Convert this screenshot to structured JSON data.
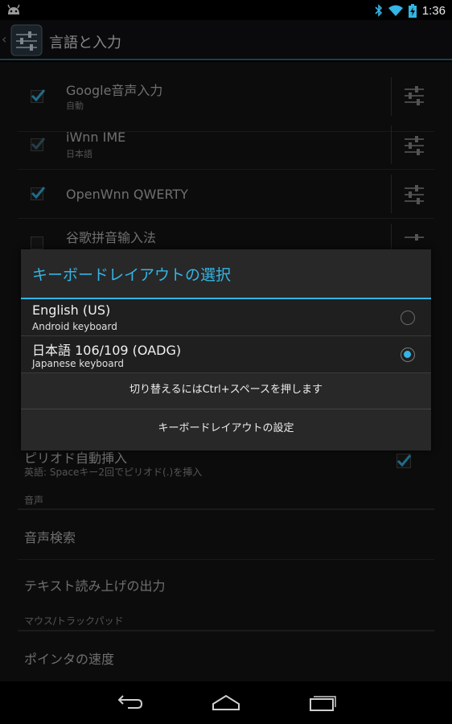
{
  "statusbar": {
    "time": "1:36",
    "icons": [
      "android-icon",
      "bluetooth-icon",
      "wifi-icon",
      "battery-charging-icon"
    ]
  },
  "actionbar": {
    "title": "言語と入力",
    "icon": "input-settings-icon"
  },
  "input_methods": [
    {
      "name": "Google音声入力",
      "sub": "自動",
      "checked": true
    },
    {
      "name": "iWnn IME",
      "sub": "日本語",
      "checked": true
    },
    {
      "name": "OpenWnn QWERTY",
      "sub": "",
      "checked": true
    },
    {
      "name": "谷歌拼音输入法",
      "sub": "",
      "checked": false
    }
  ],
  "behind": {
    "period_title": "ピリオド自動挿入",
    "period_sub": "英語: Spaceキー2回でピリオド(.)を挿入",
    "section_voice": "音声",
    "voice_search": "音声検索",
    "tts": "テキスト読み上げの出力",
    "section_mouse": "マウス/トラックパッド",
    "pointer_speed": "ポインタの速度"
  },
  "dialog": {
    "title": "キーボードレイアウトの選択",
    "options": [
      {
        "name": "English (US)",
        "sub": "Android keyboard",
        "selected": false
      },
      {
        "name": "日本語 106/109 (OADG)",
        "sub": "Japanese keyboard",
        "selected": true
      }
    ],
    "hint": "切り替えるにはCtrl+スペースを押します",
    "settings_button": "キーボードレイアウトの設定"
  },
  "colors": {
    "accent": "#33b5e5",
    "background": "#141517",
    "dialog": "#282828"
  },
  "navbar": {
    "buttons": [
      "back-icon",
      "home-icon",
      "recent-apps-icon"
    ]
  }
}
